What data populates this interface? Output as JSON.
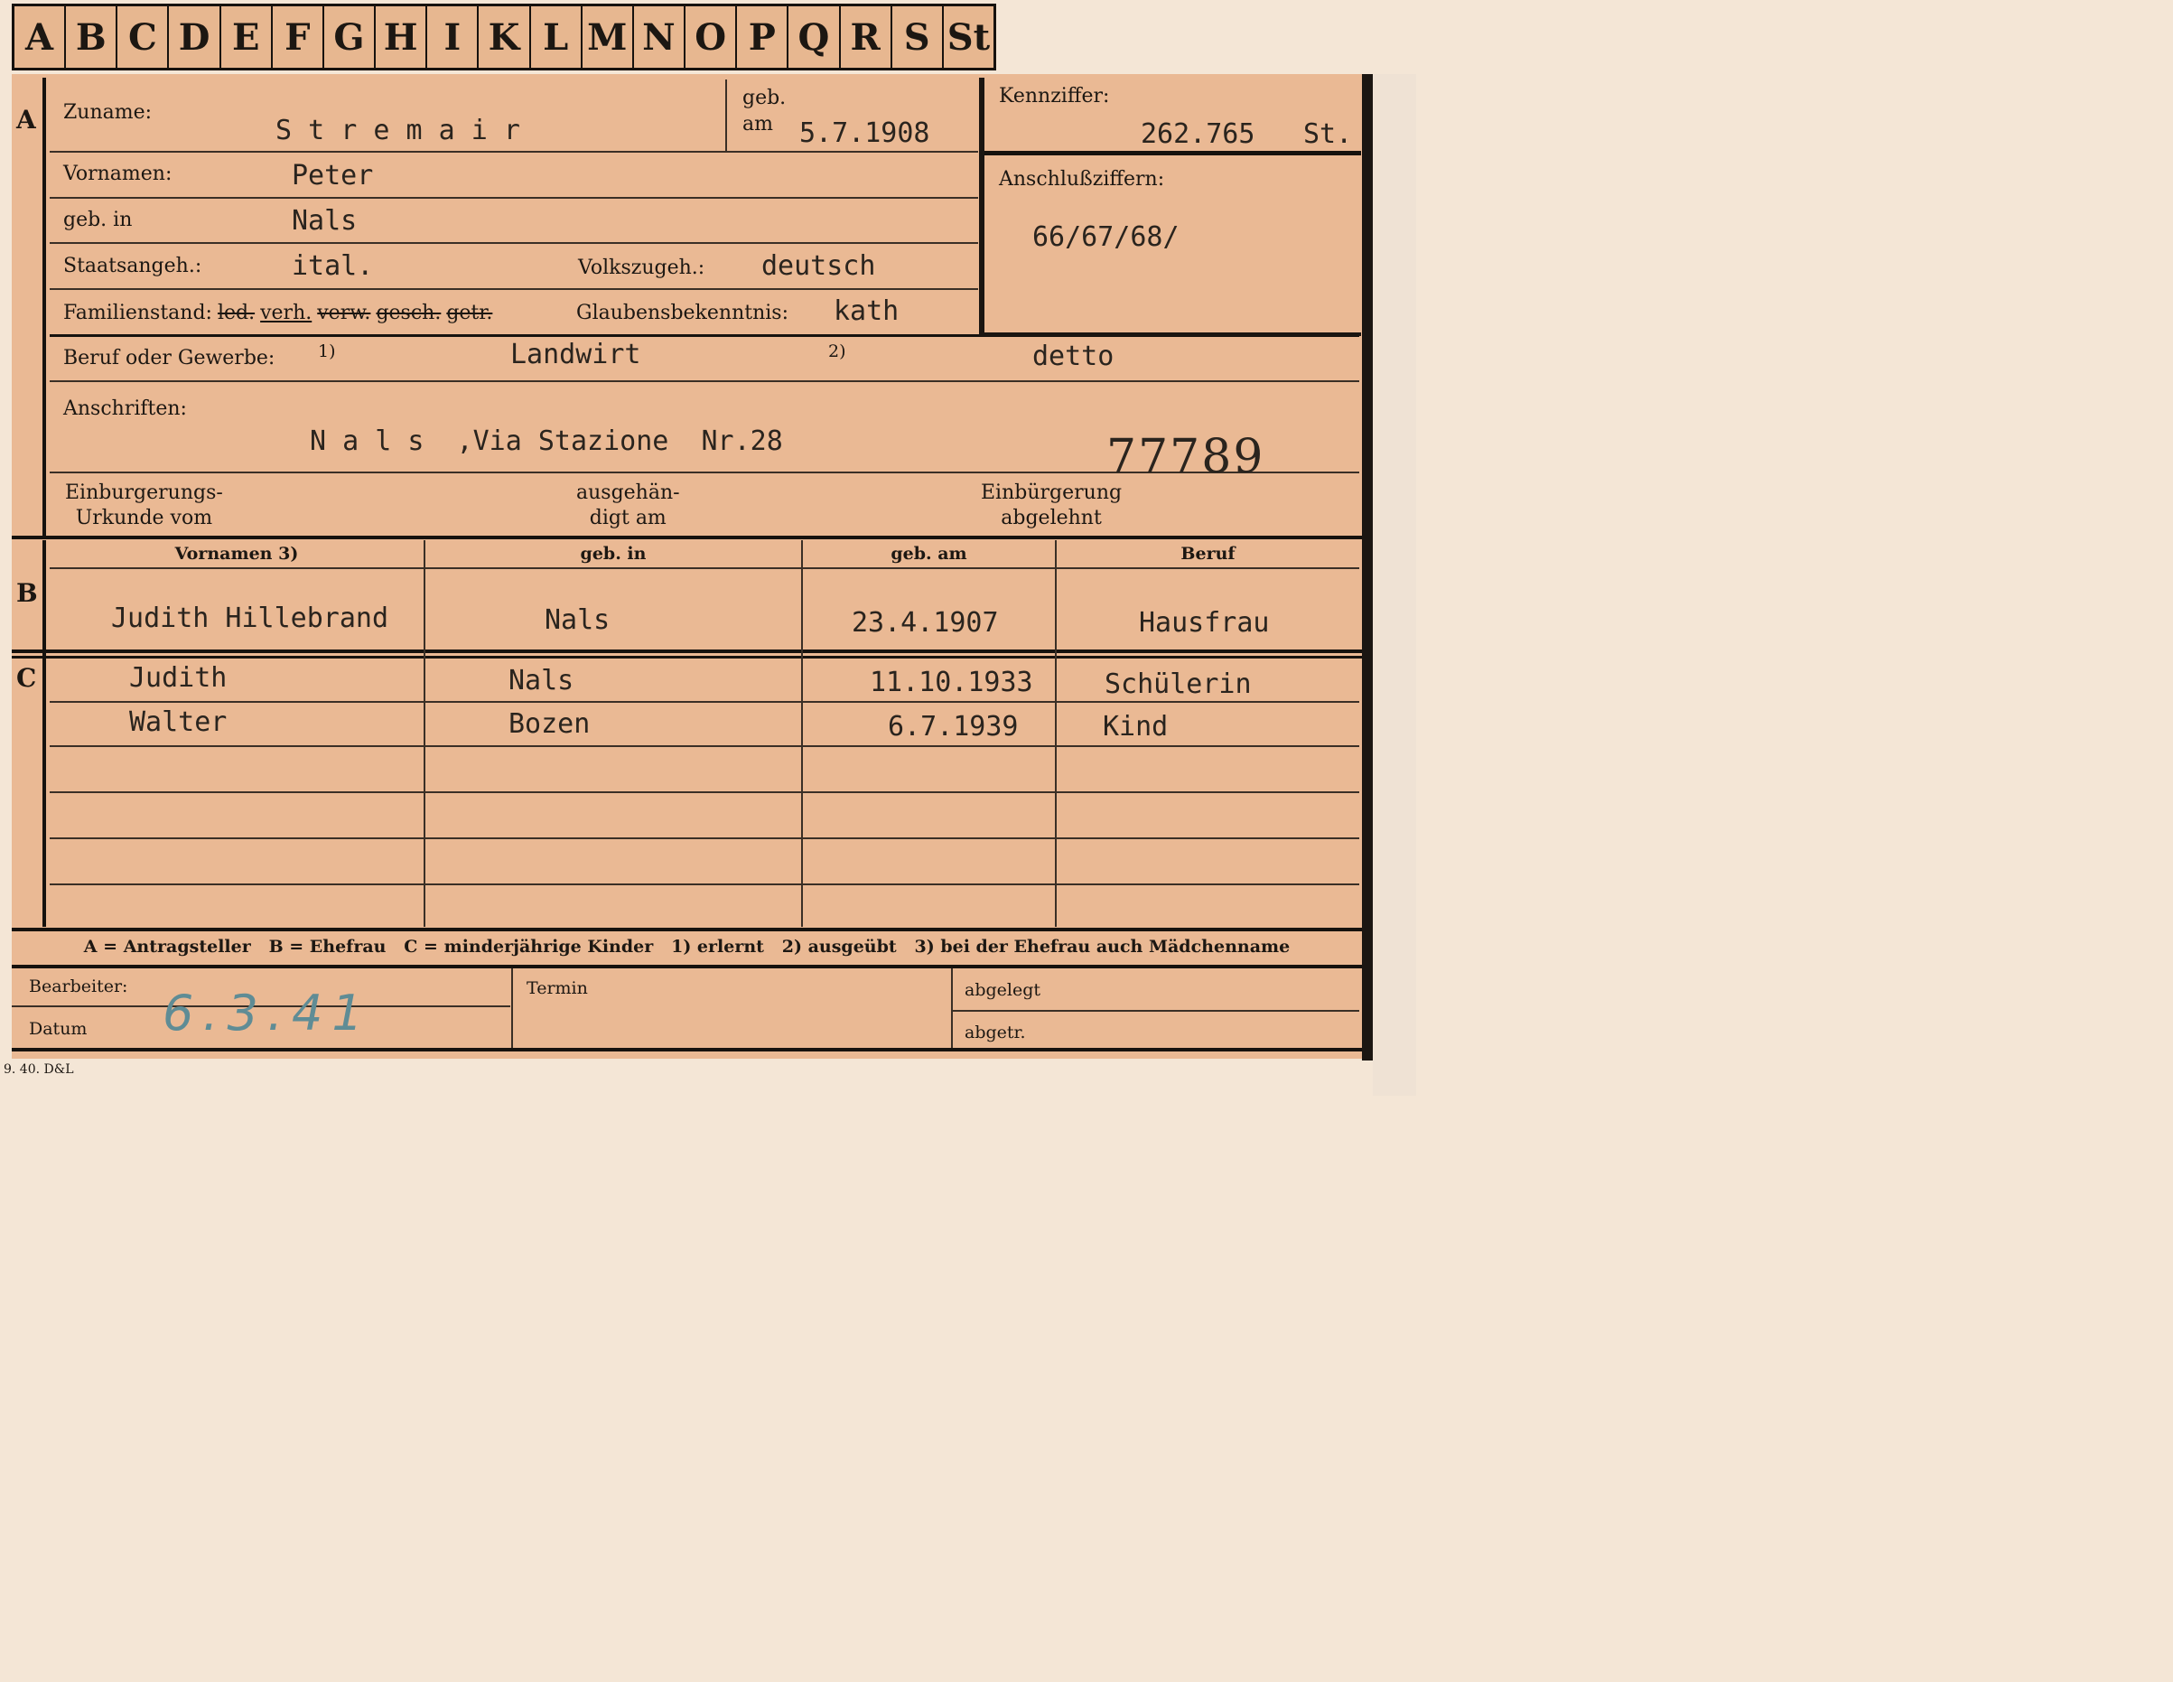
{
  "tabs": [
    "A",
    "B",
    "C",
    "D",
    "E",
    "F",
    "G",
    "H",
    "I",
    "K",
    "L",
    "M",
    "N",
    "O",
    "P",
    "Q",
    "R",
    "S",
    "St"
  ],
  "section_markers": {
    "a": "A",
    "b": "B",
    "c": "C"
  },
  "applicant": {
    "surname_label": "Zuname:",
    "surname": "S t r e m a i r",
    "born_label_line1": "geb.",
    "born_label_line2": "am",
    "born_date": "5.7.1908",
    "firstnames_label": "Vornamen:",
    "firstnames": "Peter",
    "birthplace_label": "geb. in",
    "birthplace": "Nals",
    "citizenship_label": "Staatsangeh.:",
    "citizenship": "ital.",
    "ethnicity_label": "Volkszugeh.:",
    "ethnicity": "deutsch",
    "family_status_label": "Familienstand:",
    "family_status_options": [
      "led.",
      "verh.",
      "verw.",
      "gesch.",
      "getr."
    ],
    "religion_label": "Glaubensbekenntnis:",
    "religion": "kath",
    "profession_label": "Beruf oder Gewerbe:",
    "profession_fn1": "1)",
    "profession_learned": "Landwirt",
    "profession_fn2": "2)",
    "profession_practiced": "detto",
    "address_label": "Anschriften:",
    "address": "N a l s  ,Via Stazione  Nr.28",
    "stamp_number": "77789",
    "naturalization_label_l1": "Einburgerungs-",
    "naturalization_label_l2": "Urkunde vom",
    "handed_label_l1": "ausgehän-",
    "handed_label_l2": "digt am",
    "refused_label_l1": "Einbürgerung",
    "refused_label_l2": "abgelehnt"
  },
  "reference": {
    "id_label": "Kennziffer:",
    "id_value": "262.765",
    "id_suffix": "St.",
    "linked_label": "Anschlußziffern:",
    "linked_value": "66/67/68/"
  },
  "table": {
    "headers": [
      "Vornamen 3)",
      "geb. in",
      "geb. am",
      "Beruf"
    ],
    "spouse": {
      "name": "Judith Hillebrand",
      "birthplace": "Nals",
      "birthdate": "23.4.1907",
      "profession": "Hausfrau"
    },
    "children": [
      {
        "name": "Judith",
        "birthplace": "Nals",
        "birthdate": "11.10.1933",
        "profession": "Schülerin"
      },
      {
        "name": "Walter",
        "birthplace": "Bozen",
        "birthdate": "6.7.1939",
        "profession": "Kind"
      }
    ]
  },
  "legend": "A = Antragsteller   B = Ehefrau   C = minderjährige Kinder   1) erlernt   2) ausgeübt   3) bei der Ehefrau auch Mädchenname",
  "footer": {
    "clerk_label": "Bearbeiter:",
    "date_label": "Datum",
    "date_value": "6.3.41",
    "deadline_label": "Termin",
    "filed_label": "abgelegt",
    "dispatched_label": "abgetr.",
    "print_code": "9. 40. D&L"
  }
}
